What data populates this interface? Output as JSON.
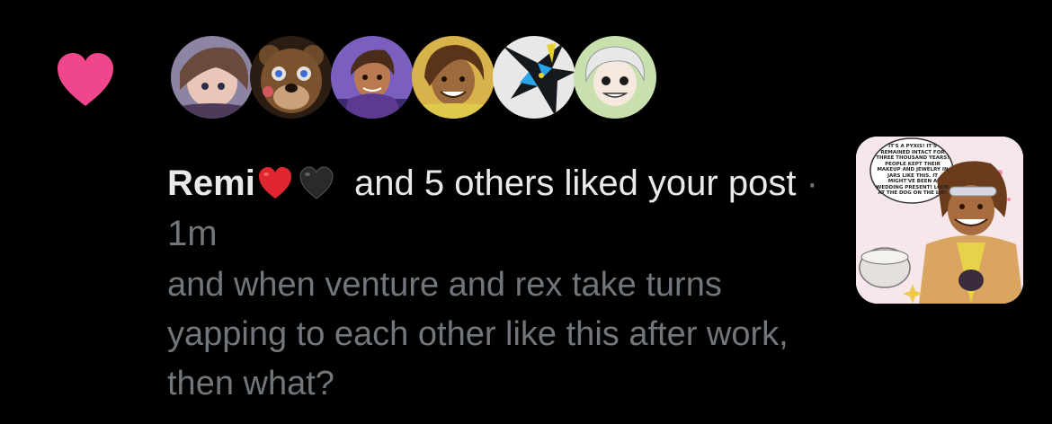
{
  "notification": {
    "type_icon": "heart-icon",
    "accent_color": "#f0468c",
    "avatars": [
      {
        "name": "avatar-1",
        "bg": "#8a7f9a"
      },
      {
        "name": "avatar-2",
        "bg": "#6e4a2c"
      },
      {
        "name": "avatar-3",
        "bg": "#5b3a8f"
      },
      {
        "name": "avatar-4",
        "bg": "#c89a3c"
      },
      {
        "name": "avatar-5",
        "bg": "#1e2830"
      },
      {
        "name": "avatar-6",
        "bg": "#cfe3b8"
      }
    ],
    "username": "Remi",
    "emoji_1": "red-heart-emoji",
    "emoji_2": "black-heart-emoji",
    "action_text": "and 5 others liked your post",
    "separator": "·",
    "timestamp": "1m",
    "post_preview": "and when venture and rex take turns yapping to each other like this after work, then what?",
    "thumbnail": {
      "bubble_text": "It's a pyxis! It's remained intact for three thousand years! People kept their makeup and jewelry in jars like this. It might've been a wedding present! Look at the dog on the lid!"
    }
  }
}
